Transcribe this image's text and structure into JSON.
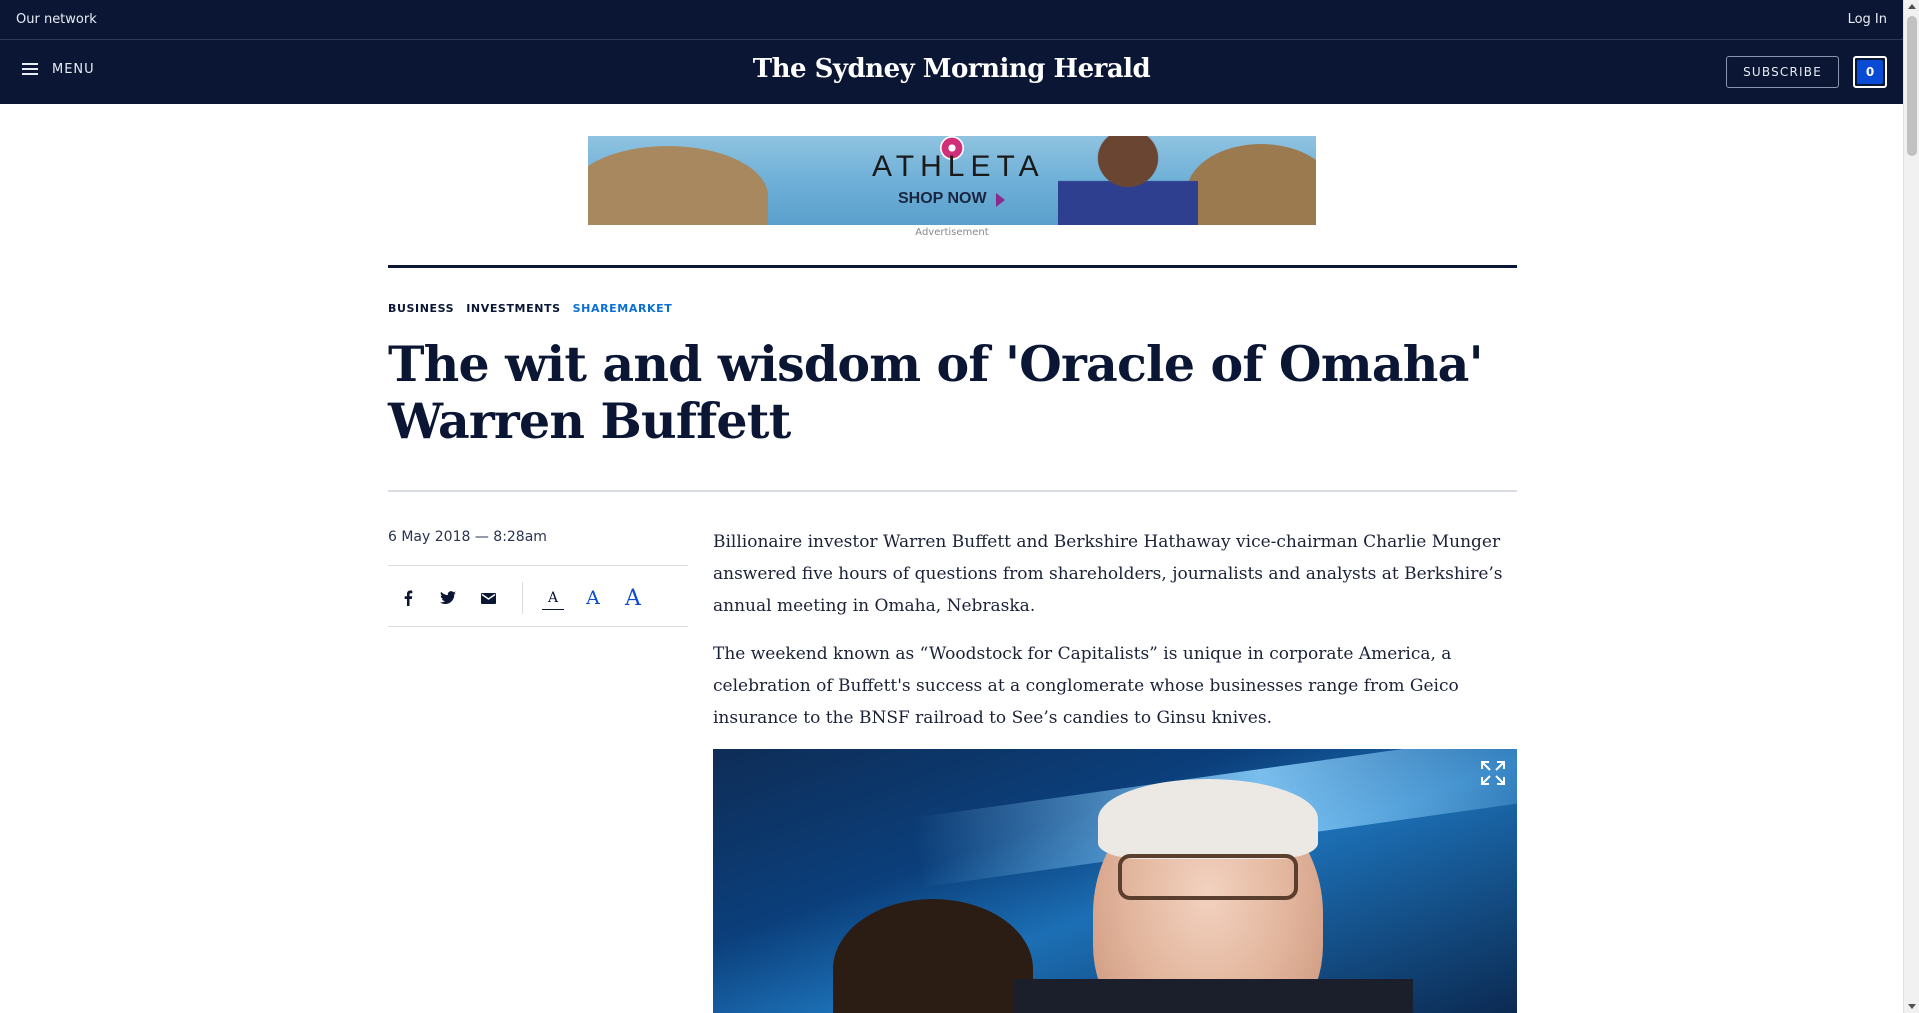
{
  "network": {
    "label": "Our network",
    "login": "Log In"
  },
  "masthead": {
    "menu_label": "MENU",
    "logo": "The Sydney Morning Herald",
    "subscribe": "SUBSCRIBE",
    "badge_count": "0"
  },
  "ad": {
    "brand": "ATHLETA",
    "cta": "SHOP NOW",
    "label": "Advertisement"
  },
  "breadcrumbs": [
    "BUSINESS",
    "INVESTMENTS",
    "SHAREMARKET"
  ],
  "article": {
    "headline": "The wit and wisdom of 'Oracle of Omaha' Warren Buffett",
    "date": "6 May 2018 — 8:28am",
    "paragraphs": [
      "Billionaire investor Warren Buffett and Berkshire Hathaway vice-chairman Charlie Munger answered five hours of questions from shareholders, journalists and analysts at Berkshire’s annual meeting in Omaha, Nebraska.",
      "The weekend known as “Woodstock for Capitalists” is unique in corporate America, a celebration of Buffett's success at a conglomerate whose businesses range from Geico insurance to the BNSF railroad to See’s candies to Ginsu knives."
    ]
  },
  "share": {
    "icons": [
      "facebook-icon",
      "twitter-icon",
      "email-icon"
    ],
    "font_sizes": [
      "A",
      "A",
      "A"
    ]
  },
  "colors": {
    "navy": "#0a1633",
    "accent_blue": "#0a6fd6",
    "badge_blue": "#0a4bd6"
  }
}
